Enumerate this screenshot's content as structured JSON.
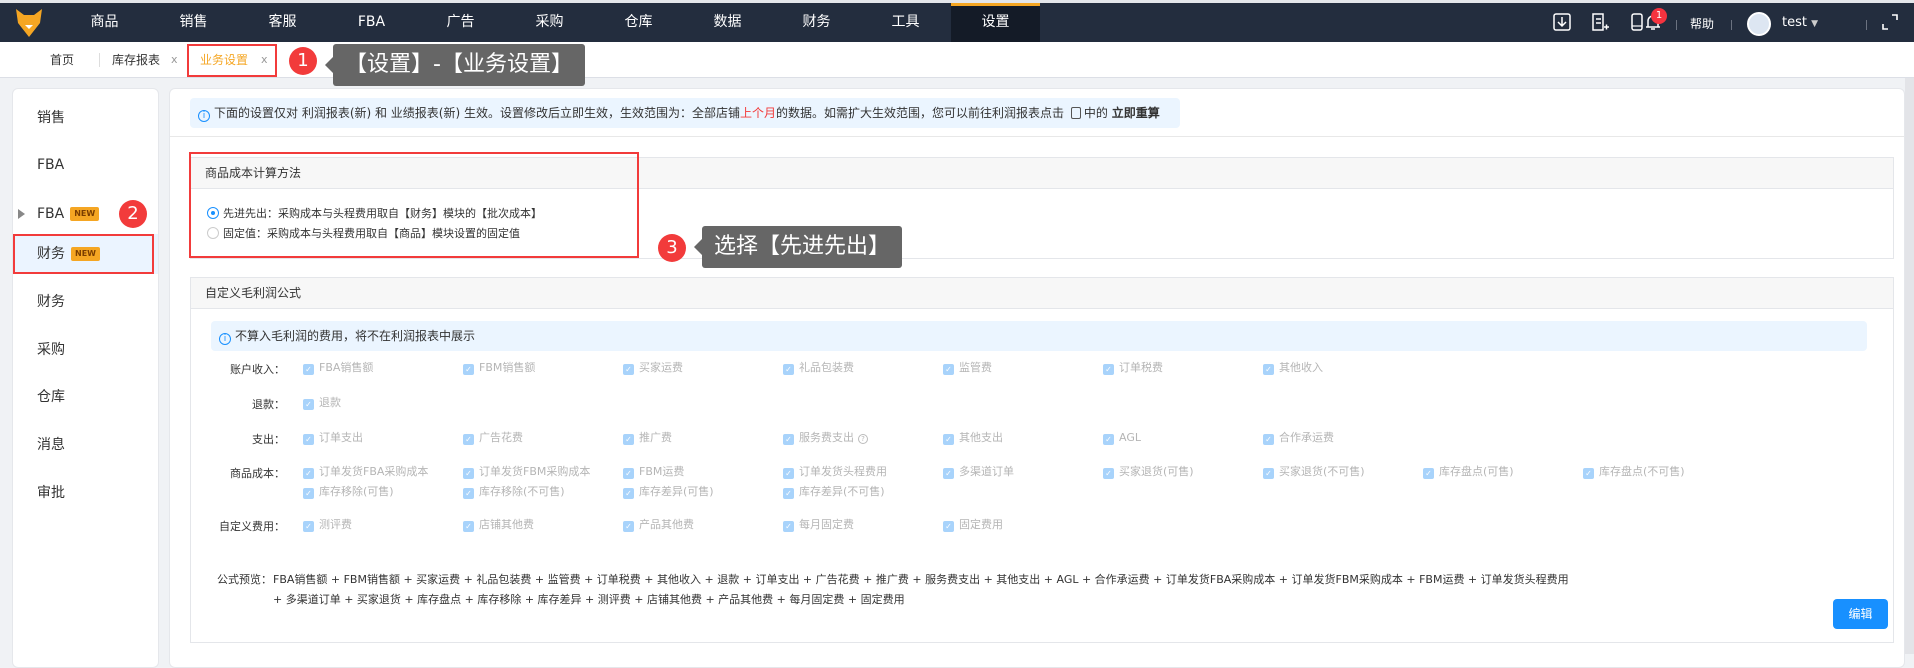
{
  "topnav": {
    "items": [
      "商品",
      "销售",
      "客服",
      "FBA",
      "广告",
      "采购",
      "仓库",
      "数据",
      "财务",
      "工具",
      "设置"
    ],
    "active": "设置",
    "notification_count": "1",
    "help": "帮助",
    "user": "test",
    "icons": [
      "download-icon",
      "add-document-icon",
      "mobile-icon",
      "bell-icon",
      "avatar",
      "fullscreen-icon"
    ]
  },
  "tabs": [
    {
      "label": "首页"
    },
    {
      "label": "库存报表",
      "close": "x"
    },
    {
      "label": "业务设置",
      "close": "x",
      "active": true
    }
  ],
  "annotations": [
    {
      "num": "1",
      "text": "【设置】-【业务设置】"
    },
    {
      "num": "2"
    },
    {
      "num": "3",
      "text": "选择【先进先出】"
    }
  ],
  "sidebar": {
    "items": [
      {
        "label": "销售"
      },
      {
        "label": "FBA"
      },
      {
        "label": "FBA",
        "badge": "NEW",
        "expandable": true
      },
      {
        "label": "财务",
        "badge": "NEW",
        "active": true
      },
      {
        "label": "财务"
      },
      {
        "label": "采购"
      },
      {
        "label": "仓库"
      },
      {
        "label": "消息"
      },
      {
        "label": "审批"
      }
    ]
  },
  "notice": {
    "part1": "下面的设置仅对 利润报表(新) 和 业绩报表(新) 生效。设置修改后立即生效，生效范围为：全部店铺",
    "highlight": "上个月",
    "part2": "的数据。如需扩大生效范围，您可以前往利润报表点击",
    "part3": "中的",
    "link": "立即重算"
  },
  "cost_method": {
    "title": "商品成本计算方法",
    "options": [
      {
        "label": "先进先出：采购成本与头程费用取自【财务】模块的【批次成本】",
        "selected": true
      },
      {
        "label": "固定值：采购成本与头程费用取自【商品】模块设置的固定值",
        "selected": false
      }
    ]
  },
  "profit_formula": {
    "title": "自定义毛利润公式",
    "notice": "不算入毛利润的费用，将不在利润报表中展示",
    "rows": [
      {
        "label": "账户收入：",
        "items": [
          "FBA销售额",
          "FBM销售额",
          "买家运费",
          "礼品包装费",
          "监管费",
          "订单税费",
          "其他收入"
        ]
      },
      {
        "label": "退款：",
        "items": [
          "退款"
        ]
      },
      {
        "label": "支出：",
        "items": [
          "订单支出",
          "广告花费",
          "推广费",
          "服务费支出",
          "其他支出",
          "AGL",
          "合作承运费"
        ]
      },
      {
        "label": "商品成本：",
        "items": [
          "订单发货FBA采购成本",
          "订单发货FBM采购成本",
          "FBM运费",
          "订单发货头程费用",
          "多渠道订单",
          "买家退货(可售)",
          "买家退货(不可售)",
          "库存盘点(可售)",
          "库存盘点(不可售)",
          "库存移除(可售)",
          "库存移除(不可售)",
          "库存差异(可售)",
          "库存差异(不可售)"
        ]
      },
      {
        "label": "自定义费用：",
        "items": [
          "测评费",
          "店铺其他费",
          "产品其他费",
          "每月固定费",
          "固定费用"
        ]
      }
    ],
    "formula_label": "公式预览：",
    "formula": "FBA销售额 + FBM销售额 + 买家运费 + 礼品包装费 + 监管费 + 订单税费 + 其他收入 + 退款 + 订单支出 + 广告花费 + 推广费 + 服务费支出 + 其他支出 + AGL + 合作承运费 + 订单发货FBA采购成本 + 订单发货FBM采购成本 + FBM运费 + 订单发货头程费用 + 多渠道订单 + 买家退货 + 库存盘点 + 库存移除 + 库存差异 + 测评费 + 店铺其他费 + 产品其他费 + 每月固定费 + 固定费用",
    "edit_button": "编辑"
  },
  "colors": {
    "nav_bg": "#232d3e",
    "accent": "#1890ff",
    "active_tab": "#f5a623",
    "annotation": "#f23b3b"
  }
}
